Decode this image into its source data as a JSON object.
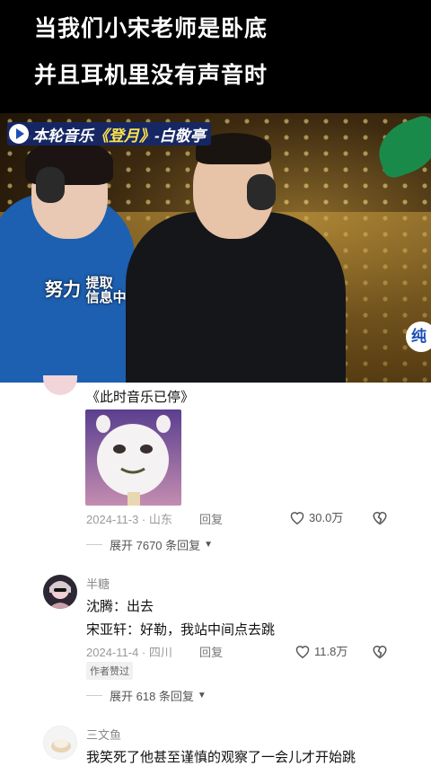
{
  "caption": {
    "line1": "当我们小宋老师是卧底",
    "line2": "并且耳机里没有声音时"
  },
  "video": {
    "banner_prefix": "本轮音乐",
    "banner_song": "《登月》",
    "banner_artist": "-白敬亭",
    "overlay_main": "努力",
    "overlay_sub1": "提取",
    "overlay_sub2": "信息中",
    "side_badge": "纯"
  },
  "comments": [
    {
      "text": "《此时音乐已停》",
      "date_location": "2024-11-3 · 山东",
      "reply_label": "回复",
      "likes": "30.0万",
      "expand": "展开 7670 条回复"
    },
    {
      "username": "半糖",
      "lines": [
        "沈腾：出去",
        "宋亚轩：好勒，我站中间点去跳"
      ],
      "date_location": "2024-11-4 · 四川",
      "reply_label": "回复",
      "likes": "11.8万",
      "badge": "作者赞过",
      "expand": "展开 618 条回复"
    },
    {
      "username": "三文鱼",
      "text": "我笑死了他甚至谨慎的观察了一会儿才开始跳"
    }
  ]
}
